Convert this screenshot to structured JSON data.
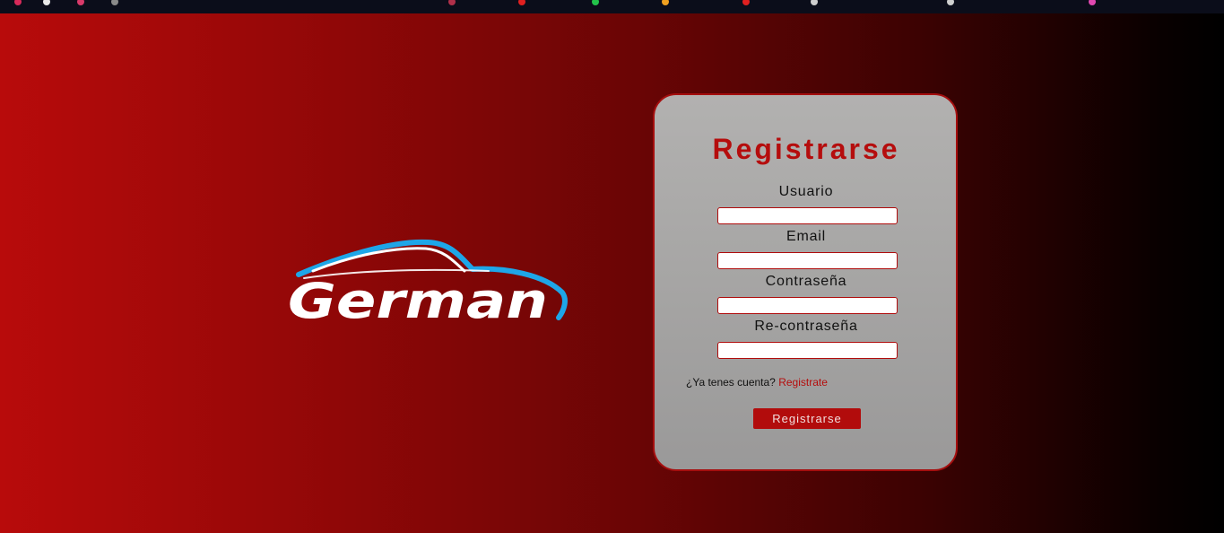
{
  "brand": {
    "logo_text": "German",
    "colors": {
      "logo_text": "#ffffff",
      "logo_swoosh": "#1ea6e8"
    }
  },
  "form": {
    "title": "Registrarse",
    "fields": [
      {
        "label": "Usuario",
        "value": "",
        "placeholder": ""
      },
      {
        "label": "Email",
        "value": "",
        "placeholder": ""
      },
      {
        "label": "Contraseña",
        "value": "",
        "placeholder": ""
      },
      {
        "label": "Re-contraseña",
        "value": "",
        "placeholder": ""
      }
    ],
    "account_prompt": "¿Ya tenes cuenta?",
    "account_link": "Registrate",
    "submit_label": "Registrarse"
  },
  "theme": {
    "accent": "#b50d0d",
    "card_background": "#a8a7a6",
    "page_gradient_start": "#b80b0b",
    "page_gradient_end": "#000000"
  }
}
